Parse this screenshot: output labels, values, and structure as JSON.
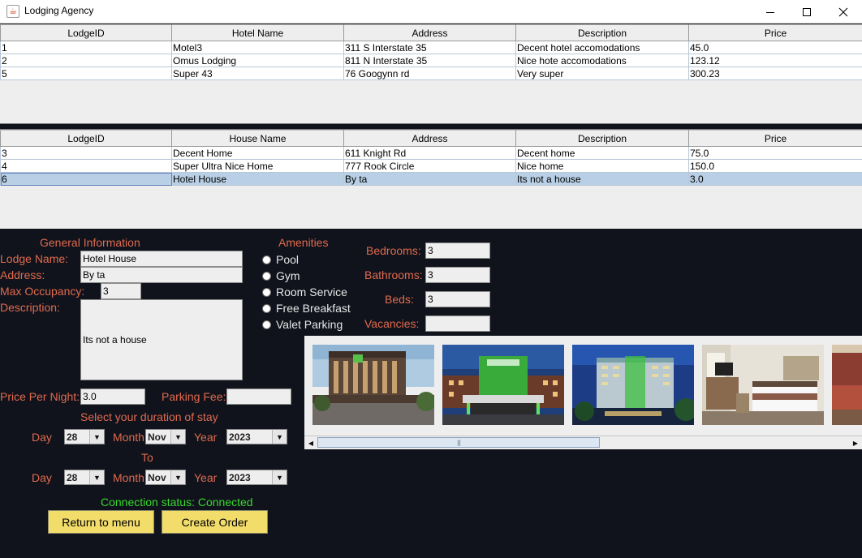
{
  "window": {
    "title": "Lodging Agency",
    "icon": "java-cup-icon"
  },
  "hotels_table": {
    "headers": [
      "LodgeID",
      "Hotel Name",
      "Address",
      "Description",
      "Price"
    ],
    "rows": [
      [
        "1",
        "Motel3",
        "311 S Interstate 35",
        "Decent hotel accomodations",
        "45.0"
      ],
      [
        "2",
        "Omus Lodging",
        "811 N Interstate 35",
        "Nice hote accomodations",
        "123.12"
      ],
      [
        "5",
        "Super 43",
        "76 Googynn rd",
        "Very super",
        "300.23"
      ]
    ]
  },
  "houses_table": {
    "headers": [
      "LodgeID",
      "House Name",
      "Address",
      "Description",
      "Price"
    ],
    "rows": [
      [
        "3",
        "Decent Home",
        "611 Knight Rd",
        "Decent home",
        "75.0"
      ],
      [
        "4",
        "Super Ultra Nice Home",
        "777 Rook Circle",
        "Nice home",
        "150.0"
      ],
      [
        "6",
        "Hotel House",
        "By ta",
        "Its not a house",
        "3.0"
      ]
    ],
    "selected_row": 2
  },
  "general_info": {
    "heading": "General Information",
    "lodge_name_label": "Lodge Name:",
    "lodge_name_value": "Hotel House",
    "address_label": "Address:",
    "address_value": "By ta",
    "max_occupancy_label": "Max Occupancy:",
    "max_occupancy_value": "3",
    "description_label": "Description:",
    "description_value": "Its not a house",
    "price_per_night_label": "Price Per Night:",
    "price_per_night_value": "3.0",
    "parking_fee_label": "Parking Fee:",
    "parking_fee_value": ""
  },
  "amenities": {
    "heading": "Amenities",
    "items": [
      "Pool",
      "Gym",
      "Room Service",
      "Free Breakfast",
      "Valet Parking"
    ]
  },
  "rooms": {
    "bedrooms_label": "Bedrooms:",
    "bedrooms_value": "3",
    "bathrooms_label": "Bathrooms:",
    "bathrooms_value": "3",
    "beds_label": "Beds:",
    "beds_value": "3",
    "vacancies_label": "Vacancies:",
    "vacancies_value": ""
  },
  "stay": {
    "heading": "Select your duration of stay",
    "to_label": "To",
    "day_label": "Day",
    "month_label": "Month",
    "year_label": "Year",
    "from": {
      "day": "28",
      "month": "Nov",
      "year": "2023"
    },
    "to": {
      "day": "28",
      "month": "Nov",
      "year": "2023"
    }
  },
  "status": {
    "connection": "Connection status: Connected"
  },
  "buttons": {
    "return_label": "Return to menu",
    "create_label": "Create Order"
  },
  "colors": {
    "background": "#10131c",
    "label": "#e06a4e",
    "status": "#38d82b",
    "button": "#f3dd6a",
    "selection": "#b8cfe5"
  }
}
